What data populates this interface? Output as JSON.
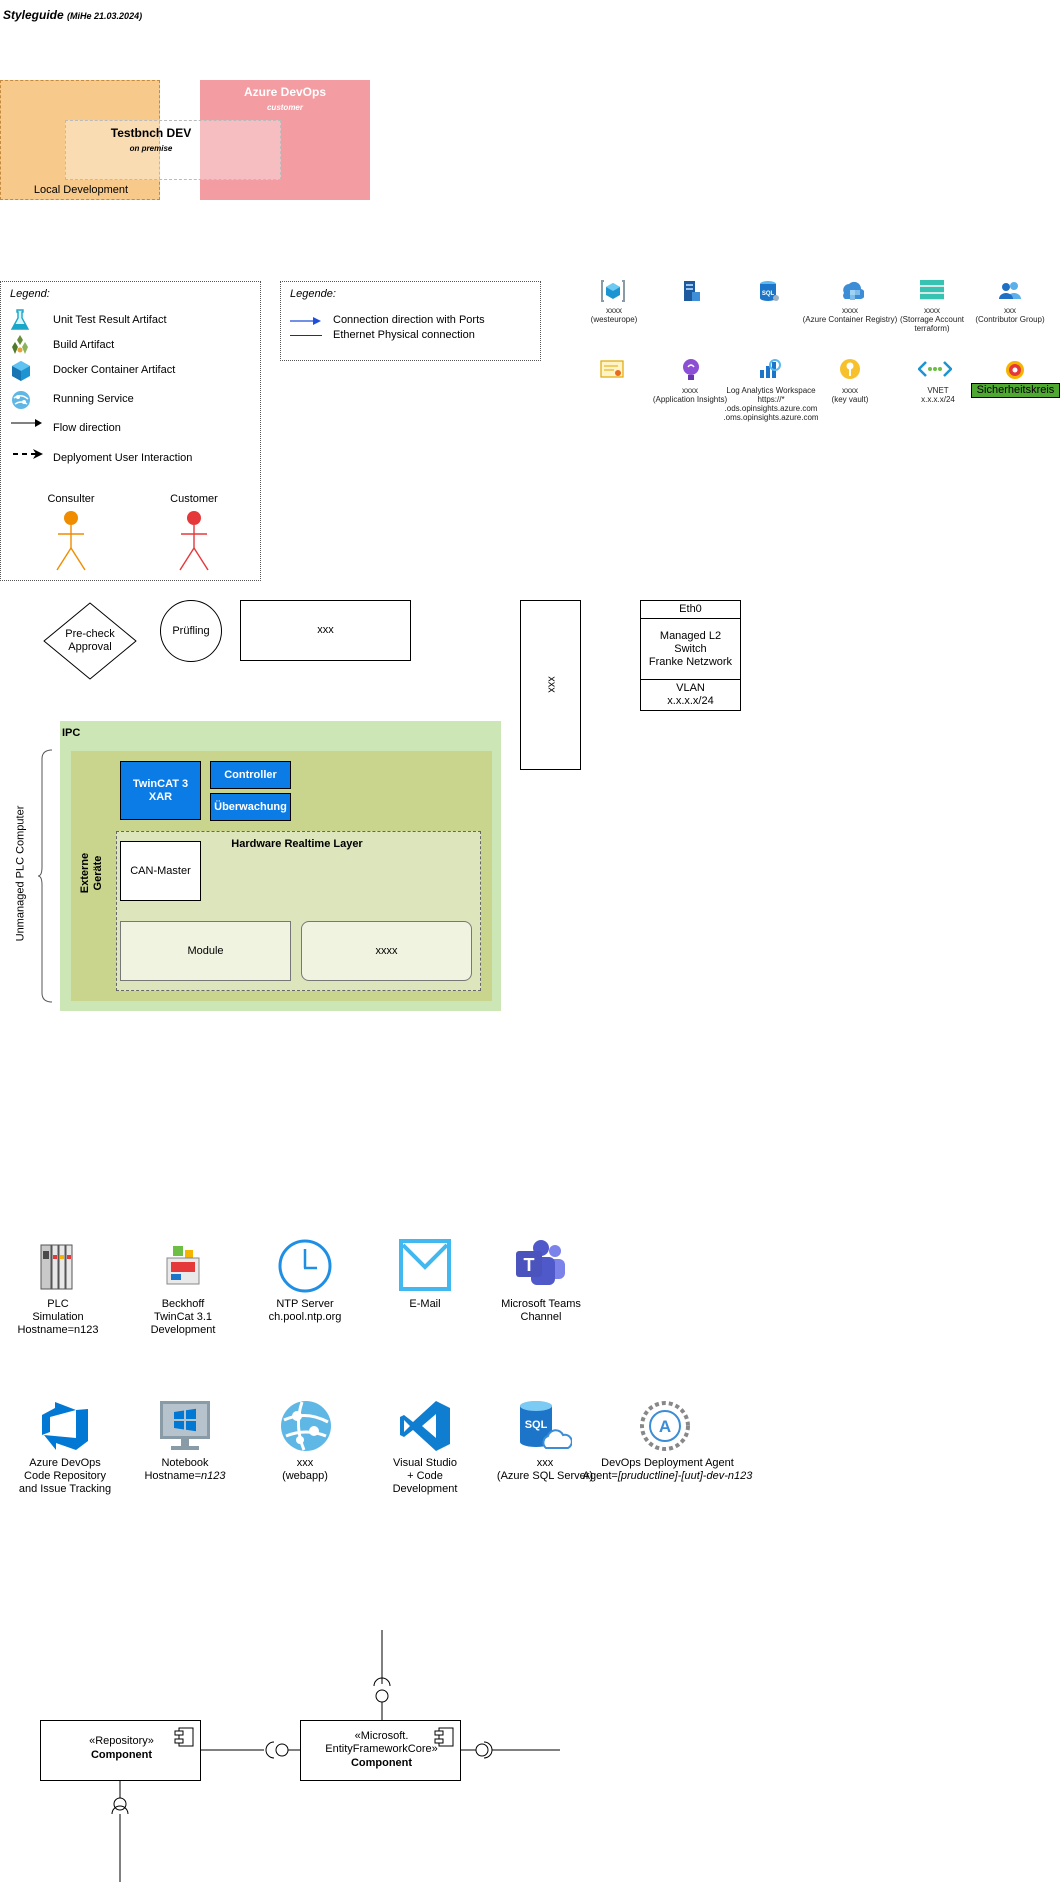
{
  "header": {
    "title": "Styleguide",
    "subtitle": "(MiHe 21.03.2024)"
  },
  "zones": {
    "local": {
      "label": "Local Development"
    },
    "azure": {
      "title": "Azure DevOps",
      "subtitle": "customer"
    },
    "testbench": {
      "title": "Testbnch DEV",
      "subtitle": "on premise"
    }
  },
  "legend": {
    "title": "Legend:",
    "items": [
      {
        "icon": "flask-icon",
        "label": "Unit Test Result Artifact"
      },
      {
        "icon": "build-artifact-icon",
        "label": "Build Artifact"
      },
      {
        "icon": "container-cube-icon",
        "label": "Docker Container Artifact"
      },
      {
        "icon": "running-service-icon",
        "label": "Running Service"
      },
      {
        "icon": "arrow-icon",
        "label": "Flow direction"
      },
      {
        "icon": "dashed-arrow-icon",
        "label": "Deplyoment User Interaction"
      }
    ],
    "actors": [
      {
        "label": "Consulter",
        "color": "#F08C00"
      },
      {
        "label": "Customer",
        "color": "#E5383B"
      }
    ]
  },
  "legend2": {
    "title": "Legende:",
    "items": [
      {
        "label": "Connection direction with Ports",
        "color": "#1F4FD8"
      },
      {
        "label": "Ethernet Physical connection",
        "color": "#333333"
      }
    ]
  },
  "azure_icons": {
    "row1": [
      {
        "icon": "resource-group-icon",
        "line1": "xxxx",
        "line2": "(westeurope)",
        "line3": ""
      },
      {
        "icon": "server-icon",
        "line1": "",
        "line2": "",
        "line3": ""
      },
      {
        "icon": "sql-database-icon",
        "line1": "",
        "line2": "",
        "line3": ""
      },
      {
        "icon": "container-registry-icon",
        "line1": "xxxx",
        "line2": "(Azure Container Registry)",
        "line3": ""
      },
      {
        "icon": "storage-account-icon",
        "line1": "xxxx",
        "line2": "(Storrage Account",
        "line3": "terraform)"
      },
      {
        "icon": "user-group-icon",
        "line1": "xxx",
        "line2": "(Contributor Group)",
        "line3": ""
      }
    ],
    "row2": [
      {
        "icon": "certificate-icon",
        "line1": "",
        "line2": "",
        "line3": "",
        "line4": ""
      },
      {
        "icon": "app-insights-icon",
        "line1": "xxxx",
        "line2": "(Application Insights)",
        "line3": "",
        "line4": ""
      },
      {
        "icon": "log-analytics-icon",
        "line1": "Log Analytics Workspace",
        "line2": "https://*",
        "line3": ".ods.opinsights.azure.com",
        "line4": ".oms.opinsights.azure.com"
      },
      {
        "icon": "key-vault-icon",
        "line1": "xxxx",
        "line2": "(key vault)",
        "line3": "",
        "line4": ""
      },
      {
        "icon": "vnet-icon",
        "line1": "VNET",
        "line2": "x.x.x.x/24",
        "line3": "",
        "line4": ""
      },
      {
        "icon": "safety-circuit-icon",
        "line1": "Sicherheitskreis",
        "line2": "",
        "line3": "",
        "line4": ""
      }
    ]
  },
  "shapes": {
    "precheck": "Pre-check\nApproval",
    "pruefling": "Prüfling",
    "rect_xxx": "xxx",
    "vertical_xxx": "xxx",
    "switch": {
      "top": "Eth0",
      "middle": "Managed L2\nSwitch\nFranke Netzwork",
      "bottom": "VLAN\nx.x.x.x/24"
    }
  },
  "ipc": {
    "title": "IPC",
    "brace_label": "Unmanaged PLC Computer",
    "externe": "Externe\nGeräte",
    "twincat": "TwinCAT 3\nXAR",
    "controller": "Controller",
    "ueberwachung": "Überwachung",
    "hw_layer": "Hardware Realtime Layer",
    "can_master": "CAN-Master",
    "module": "Module",
    "xxxx": "xxxx"
  },
  "service_icons_row1": [
    {
      "icon": "plc-icon",
      "text": "PLC\nSimulation\nHostname=n123"
    },
    {
      "icon": "beckhoff-twincat-icon",
      "text": "Beckhoff\nTwinCat 3.1\nDevelopment"
    },
    {
      "icon": "clock-icon",
      "text": "NTP Server\nch.pool.ntp.org"
    },
    {
      "icon": "mail-icon",
      "text": "E-Mail"
    },
    {
      "icon": "teams-icon",
      "text": "Microsoft Teams\nChannel"
    }
  ],
  "service_icons_row2": [
    {
      "icon": "azure-devops-icon",
      "text": "Azure DevOps\nCode Repository\nand Issue Tracking"
    },
    {
      "icon": "notebook-icon",
      "text": "Notebook\nHostname=",
      "italic": "n123"
    },
    {
      "icon": "webapp-icon",
      "text": "xxx\n(webapp)"
    },
    {
      "icon": "vscode-icon",
      "text": "Visual Studio\n+ Code\nDevelopment"
    },
    {
      "icon": "sql-server-icon",
      "text": "xxx\n(Azure SQL Server)"
    },
    {
      "icon": "deployment-agent-icon",
      "text": "DevOps Deployment Agent\nAgent=",
      "italic": "[pruductline]-[uut]-dev-n123"
    }
  ],
  "components": {
    "repo": {
      "stereotype": "«Repository»",
      "name": "Component"
    },
    "ef": {
      "stereotype": "«Microsoft.\nEntityFrameworkCore»",
      "name": "Component"
    }
  },
  "colors": {
    "local_bg": "#F7C98A",
    "azure_bg": "#F39CA2",
    "ipc_outer": "#CDE6B5",
    "ipc_inner": "#C9D48D",
    "hw_layer": "#DCE5BC",
    "blue_box": "#0B7CE6",
    "safety_bg": "#4FA832"
  }
}
